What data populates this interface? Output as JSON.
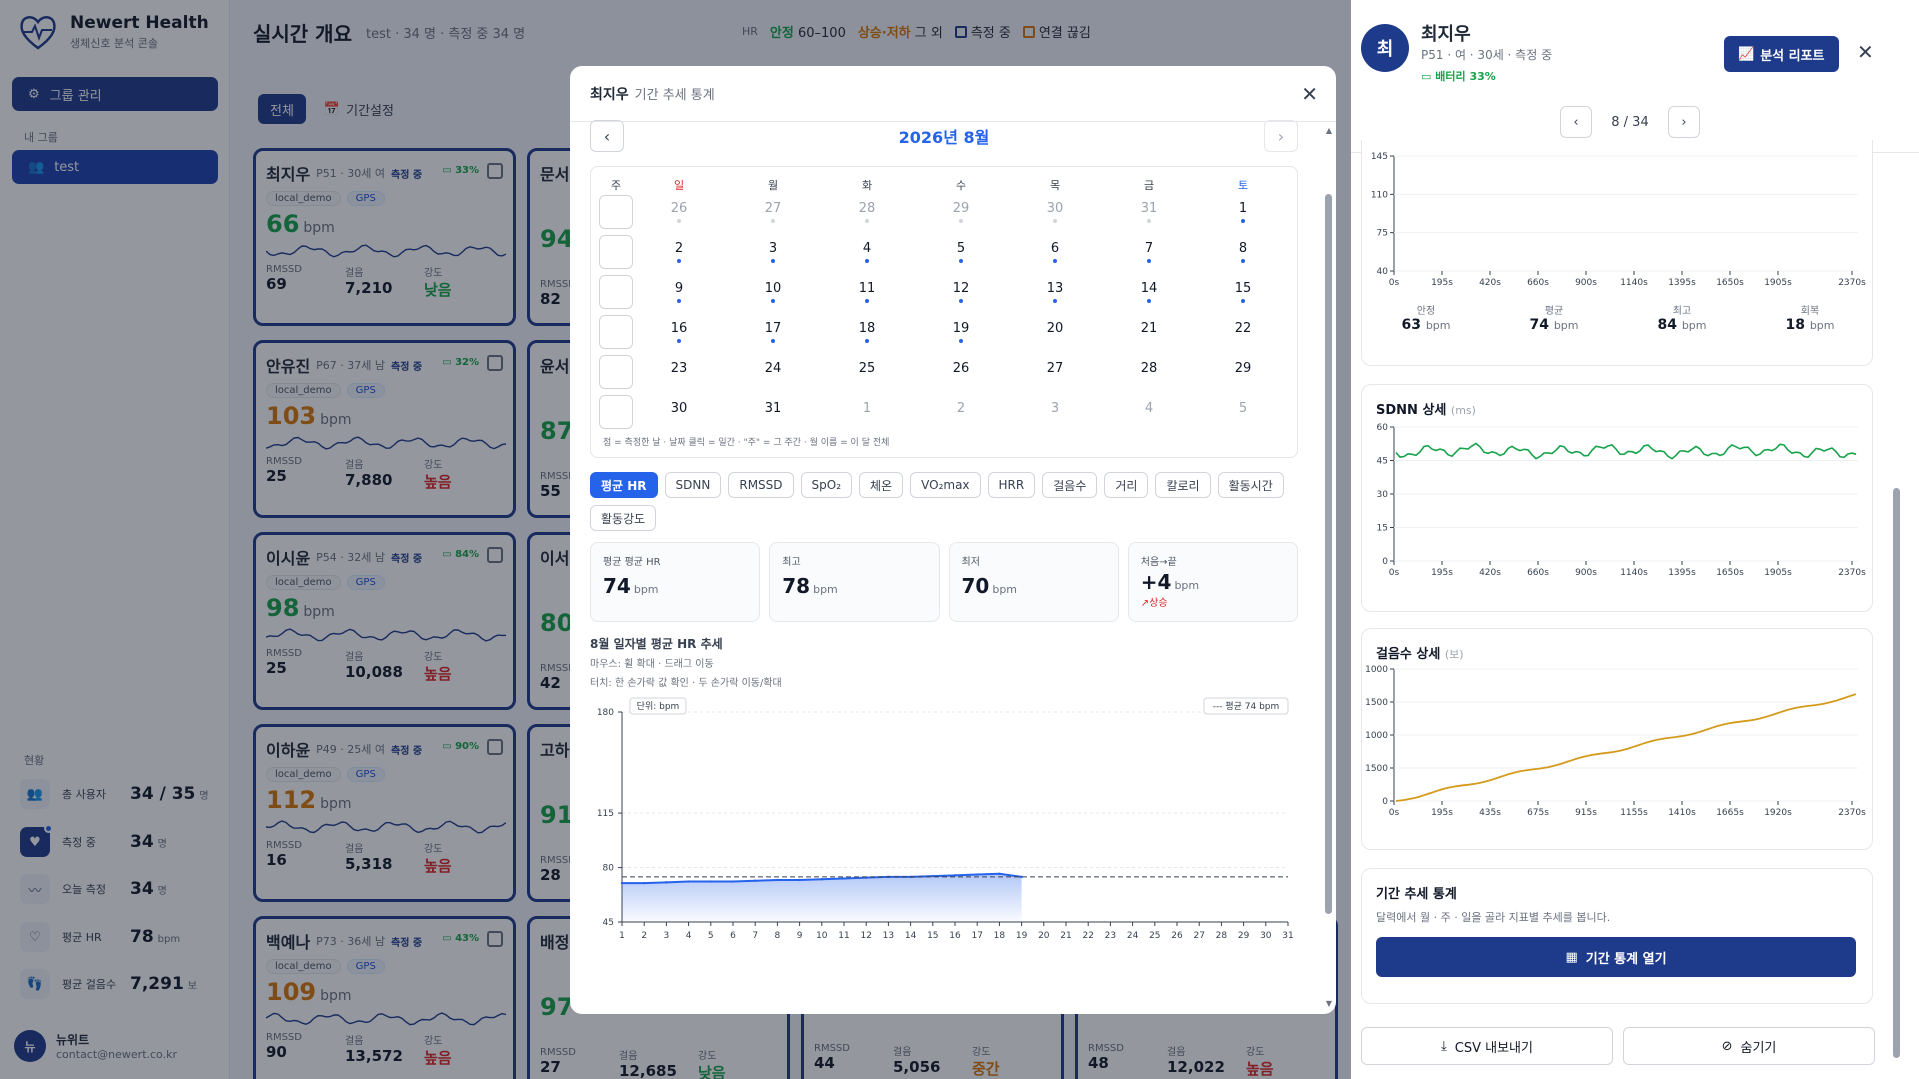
{
  "brand": {
    "title": "Newert Health",
    "subtitle": "생체신호 분석 콘솔"
  },
  "sidebar": {
    "group_mgmt": "그룹 관리",
    "my_groups_label": "내 그룹",
    "group_item": "test",
    "status_label": "현황",
    "stats": [
      {
        "label": "총 사용자",
        "value": "34 / 35",
        "unit": "명",
        "icon": "users-icon"
      },
      {
        "label": "측정 중",
        "value": "34",
        "unit": "명",
        "icon": "heart-monitor-icon"
      },
      {
        "label": "오늘 측정",
        "value": "34",
        "unit": "명",
        "icon": "activity-icon"
      },
      {
        "label": "평균 HR",
        "value": "78",
        "unit": "bpm",
        "icon": "heart-icon"
      },
      {
        "label": "평균 걸음수",
        "value": "7,291",
        "unit": "보",
        "icon": "footprints-icon"
      }
    ],
    "user": {
      "initial": "뉴",
      "name": "뉴위트",
      "email": "contact@newert.co.kr"
    }
  },
  "header": {
    "title": "실시간 개요",
    "subtitle": "test · 34 명 · 측정 중 34 명",
    "legend": {
      "hr": "HR",
      "stable": "안정",
      "stable_range": "60–100",
      "rise": "상승·저하",
      "rise_tail": "그 외",
      "measuring": "측정 중",
      "conn": "연결 끊김"
    }
  },
  "filters": {
    "all": "전체",
    "period": "기간설정"
  },
  "cards": [
    {
      "name": "최지우",
      "meta": "P51 · 30세 여",
      "tag": "측정 중",
      "battery": "33%",
      "device": "local_demo",
      "gps": "GPS",
      "bpm": "66",
      "bpm_color": "#16a34a",
      "rmssd": "69",
      "steps": "7,210",
      "intensity": "낮음",
      "int_color": "#16a34a"
    },
    {
      "name": "안유진",
      "meta": "P67 · 37세 남",
      "tag": "측정 중",
      "battery": "32%",
      "device": "local_demo",
      "gps": "GPS",
      "bpm": "103",
      "bpm_color": "#d97706",
      "rmssd": "25",
      "steps": "7,880",
      "intensity": "높음",
      "int_color": "#dc2626"
    },
    {
      "name": "이시윤",
      "meta": "P54 · 32세 남",
      "tag": "측정 중",
      "battery": "84%",
      "device": "local_demo",
      "gps": "GPS",
      "bpm": "98",
      "bpm_color": "#16a34a",
      "rmssd": "25",
      "steps": "10,088",
      "intensity": "높음",
      "int_color": "#dc2626"
    },
    {
      "name": "이하윤",
      "meta": "P49 · 25세 여",
      "tag": "측정 중",
      "battery": "90%",
      "device": "local_demo",
      "gps": "GPS",
      "bpm": "112",
      "bpm_color": "#d97706",
      "rmssd": "16",
      "steps": "5,318",
      "intensity": "높음",
      "int_color": "#dc2626"
    },
    {
      "name": "백예나",
      "meta": "P73 · 36세 남",
      "tag": "측정 중",
      "battery": "43%",
      "device": "local_demo",
      "gps": "GPS",
      "bpm": "109",
      "bpm_color": "#d97706",
      "rmssd": "90",
      "steps": "13,572",
      "intensity": "높음",
      "int_color": "#dc2626"
    }
  ],
  "cards2": [
    {
      "name": "문서",
      "bpm": "94",
      "rmssd": "82"
    },
    {
      "name": "윤서",
      "bpm": "87",
      "rmssd": "55"
    },
    {
      "name": "이서",
      "bpm": "80",
      "rmssd": "42"
    },
    {
      "name": "고하",
      "bpm": "91",
      "rmssd": "28"
    },
    {
      "name": "배정",
      "bpm": "97",
      "rmssd": "27",
      "steps": "12,685",
      "intensity": "낮음"
    }
  ],
  "cards_bottom": [
    {
      "rmssd": "44",
      "steps": "5,056",
      "intensity": "중간"
    },
    {
      "rmssd": "48",
      "steps": "12,022",
      "intensity": "높음"
    }
  ],
  "card_labels": {
    "rmssd": "RMSSD",
    "steps": "걸음",
    "intensity": "강도",
    "bpm_unit": "bpm"
  },
  "modal": {
    "name": "최지우",
    "subtitle": "기간 추세 통계",
    "month_title": "2026년 8월",
    "dow": [
      "주",
      "일",
      "월",
      "화",
      "수",
      "목",
      "금",
      "토"
    ],
    "weeks": [
      [
        {
          "d": "26",
          "o": true,
          "m": true
        },
        {
          "d": "27",
          "o": true,
          "m": true
        },
        {
          "d": "28",
          "o": true,
          "m": true
        },
        {
          "d": "29",
          "o": true,
          "m": true
        },
        {
          "d": "30",
          "o": true,
          "m": true
        },
        {
          "d": "31",
          "o": true,
          "m": true
        },
        {
          "d": "1",
          "o": false,
          "m": true
        }
      ],
      [
        {
          "d": "2",
          "o": false,
          "m": true
        },
        {
          "d": "3",
          "o": false,
          "m": true
        },
        {
          "d": "4",
          "o": false,
          "m": true
        },
        {
          "d": "5",
          "o": false,
          "m": true
        },
        {
          "d": "6",
          "o": false,
          "m": true
        },
        {
          "d": "7",
          "o": false,
          "m": true
        },
        {
          "d": "8",
          "o": false,
          "m": true
        }
      ],
      [
        {
          "d": "9",
          "o": false,
          "m": true
        },
        {
          "d": "10",
          "o": false,
          "m": true
        },
        {
          "d": "11",
          "o": false,
          "m": true
        },
        {
          "d": "12",
          "o": false,
          "m": true
        },
        {
          "d": "13",
          "o": false,
          "m": true
        },
        {
          "d": "14",
          "o": false,
          "m": true
        },
        {
          "d": "15",
          "o": false,
          "m": true
        }
      ],
      [
        {
          "d": "16",
          "o": false,
          "m": true
        },
        {
          "d": "17",
          "o": false,
          "m": true
        },
        {
          "d": "18",
          "o": false,
          "m": true
        },
        {
          "d": "19",
          "o": false,
          "m": true
        },
        {
          "d": "20",
          "o": false,
          "m": false
        },
        {
          "d": "21",
          "o": false,
          "m": false
        },
        {
          "d": "22",
          "o": false,
          "m": false
        }
      ],
      [
        {
          "d": "23",
          "o": false,
          "m": false
        },
        {
          "d": "24",
          "o": false,
          "m": false
        },
        {
          "d": "25",
          "o": false,
          "m": false
        },
        {
          "d": "26",
          "o": false,
          "m": false
        },
        {
          "d": "27",
          "o": false,
          "m": false
        },
        {
          "d": "28",
          "o": false,
          "m": false
        },
        {
          "d": "29",
          "o": false,
          "m": false
        }
      ],
      [
        {
          "d": "30",
          "o": false,
          "m": false
        },
        {
          "d": "31",
          "o": false,
          "m": false
        },
        {
          "d": "1",
          "o": true,
          "m": false
        },
        {
          "d": "2",
          "o": true,
          "m": false
        },
        {
          "d": "3",
          "o": true,
          "m": false
        },
        {
          "d": "4",
          "o": true,
          "m": false
        },
        {
          "d": "5",
          "o": true,
          "m": false
        }
      ]
    ],
    "cal_hint": "점 = 측정한 날 · 날짜 클릭 = 일간 · \"주\" = 그 주간 · 월 이름 = 이 달 전체",
    "metrics": [
      "평균 HR",
      "SDNN",
      "RMSSD",
      "SpO₂",
      "체온",
      "VO₂max",
      "HRR",
      "걸음수",
      "거리",
      "칼로리",
      "활동시간",
      "활동강도"
    ],
    "active_metric": "평균 HR",
    "kpis": [
      {
        "label": "평균 평균 HR",
        "value": "74",
        "unit": "bpm"
      },
      {
        "label": "최고",
        "value": "78",
        "unit": "bpm"
      },
      {
        "label": "최저",
        "value": "70",
        "unit": "bpm"
      },
      {
        "label": "처음→끝",
        "value": "+4",
        "unit": "bpm",
        "trend": "상승"
      }
    ],
    "chart_title": "8월 일자별 평균 HR 추세",
    "hint_mouse": "마우스: 휠 확대 · 드래그 이동",
    "hint_touch": "터치: 한 손가락 값 확인 · 두 손가락 이동/확대",
    "unit_badge": "단위: bpm",
    "avg_badge": "평균 74 bpm"
  },
  "chart_data": [
    {
      "type": "area",
      "title": "8월 일자별 평균 HR 추세",
      "ylabel": "단위: bpm",
      "x": [
        1,
        2,
        3,
        4,
        5,
        6,
        7,
        8,
        9,
        10,
        11,
        12,
        13,
        14,
        15,
        16,
        17,
        18,
        19
      ],
      "values": [
        70,
        70,
        70.5,
        71,
        71,
        71,
        71.5,
        72,
        72,
        72.5,
        73,
        73.5,
        74,
        74,
        74.5,
        75,
        75.5,
        76,
        74
      ],
      "ylim": [
        45,
        180
      ],
      "yticks": [
        45,
        80,
        115,
        180
      ],
      "xticks": [
        1,
        2,
        3,
        4,
        5,
        6,
        7,
        8,
        9,
        10,
        11,
        12,
        13,
        14,
        15,
        16,
        17,
        18,
        19,
        20,
        21,
        22,
        23,
        24,
        25,
        26,
        27,
        28,
        29,
        30,
        31
      ],
      "reference_line": {
        "label": "평균 74 bpm",
        "value": 74
      }
    },
    {
      "type": "line",
      "title": "",
      "ylabel": "",
      "yticks": [
        40,
        75,
        110,
        145
      ],
      "xticks": [
        "0s",
        "195s",
        "420s",
        "660s",
        "900s",
        "1140s",
        "1395s",
        "1650s",
        "1905s",
        "2370s"
      ]
    },
    {
      "type": "line",
      "title": "SDNN 상세",
      "ylabel": "(ms)",
      "ylim": [
        0,
        60
      ],
      "yticks": [
        0,
        15,
        30,
        45,
        60
      ],
      "xticks": [
        "0s",
        "195s",
        "420s",
        "660s",
        "900s",
        "1140s",
        "1395s",
        "1650s",
        "1905s",
        "2370s"
      ]
    },
    {
      "type": "line",
      "title": "걸음수 상세",
      "ylabel": "(보)",
      "yticks": [
        "0",
        "1500",
        "1000",
        "1500",
        "1000"
      ],
      "xticks": [
        "0s",
        "195s",
        "435s",
        "675s",
        "915s",
        "1155s",
        "1410s",
        "1665s",
        "1920s",
        "2370s"
      ]
    }
  ],
  "panel": {
    "initial": "최",
    "name": "최지우",
    "meta": "P51 · 여 · 30세 · 측정 중",
    "battery": "배터리 33%",
    "report": "분석 리포트",
    "pager": "8 / 34",
    "hr_summary": [
      {
        "label": "안정",
        "value": "63",
        "unit": "bpm"
      },
      {
        "label": "평균",
        "value": "74",
        "unit": "bpm"
      },
      {
        "label": "최고",
        "value": "84",
        "unit": "bpm"
      },
      {
        "label": "회복",
        "value": "18",
        "unit": "bpm"
      }
    ],
    "sdnn_title": "SDNN 상세",
    "sdnn_unit": "(ms)",
    "steps_title": "걸음수 상세",
    "steps_unit": "(보)",
    "trend_title": "기간 추세 통계",
    "trend_desc": "달력에서 월 · 주 · 일을 골라 지표별 추세를 봅니다.",
    "trend_btn": "기간 통계 열기",
    "csv": "CSV 내보내기",
    "hide": "숨기기"
  },
  "colors": {
    "navy": "#1e3a8a",
    "blue": "#2563eb",
    "green": "#16a34a",
    "amber": "#d97706",
    "red": "#dc2626",
    "sdnn_line": "#16a34a",
    "steps_line": "#d49a1a"
  }
}
